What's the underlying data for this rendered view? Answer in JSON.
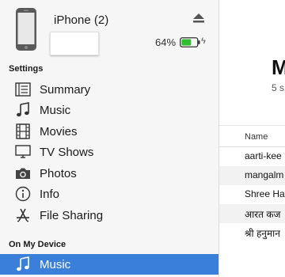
{
  "device": {
    "name": "iPhone (2)",
    "battery_percent": "64%",
    "battery_level": 0.64,
    "battery_color": "#2fbe2f"
  },
  "sidebar": {
    "settings_label": "Settings",
    "settings_items": [
      {
        "label": "Summary",
        "icon": "summary-icon"
      },
      {
        "label": "Music",
        "icon": "music-note-icon"
      },
      {
        "label": "Movies",
        "icon": "film-icon"
      },
      {
        "label": "TV Shows",
        "icon": "tv-icon"
      },
      {
        "label": "Photos",
        "icon": "camera-icon"
      },
      {
        "label": "Info",
        "icon": "info-icon"
      },
      {
        "label": "File Sharing",
        "icon": "app-store-icon"
      }
    ],
    "on_device_label": "On My Device",
    "on_device_items": [
      {
        "label": "Music",
        "icon": "music-note-icon",
        "selected": true
      }
    ],
    "selected_color": "#3a7fd9"
  },
  "main": {
    "title": "M",
    "subtitle": "5 s",
    "column_name": "Name",
    "rows": [
      "aarti-kee",
      "mangalm",
      "Shree Ha",
      "आरत कज",
      "श्री हनुमान"
    ]
  }
}
